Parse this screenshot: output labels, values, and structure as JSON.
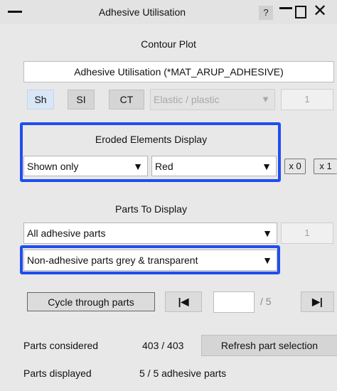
{
  "window": {
    "title": "Adhesive Utilisation",
    "help_label": "?"
  },
  "contour": {
    "heading": "Contour Plot",
    "field_text": "Adhesive Utilisation (*MAT_ARUP_ADHESIVE)",
    "btn_sh": "Sh",
    "btn_si": "SI",
    "btn_ct": "CT",
    "mode_select": "Elastic / plastic",
    "index_value": "1"
  },
  "eroded": {
    "heading": "Eroded Elements Display",
    "display_select": "Shown only",
    "color_select": "Red",
    "x0_label": "x 0",
    "x1_label": "x 1"
  },
  "parts": {
    "heading": "Parts To Display",
    "parts_select": "All adhesive parts",
    "parts_index": "1",
    "nonadhesive_select": "Non-adhesive parts grey & transparent"
  },
  "cycle": {
    "button_label": "Cycle through parts",
    "first_icon": "skip-first-icon",
    "page_value": "",
    "page_total": "/ 5",
    "last_icon": "skip-last-icon"
  },
  "status": {
    "considered_label": "Parts considered",
    "considered_value": "403 / 403",
    "refresh_label": "Refresh part selection",
    "displayed_label": "Parts displayed",
    "displayed_value": "5 / 5 adhesive parts"
  },
  "colors": {
    "highlight": "#1f4ef0",
    "panel_bg": "#e8e8e8"
  }
}
